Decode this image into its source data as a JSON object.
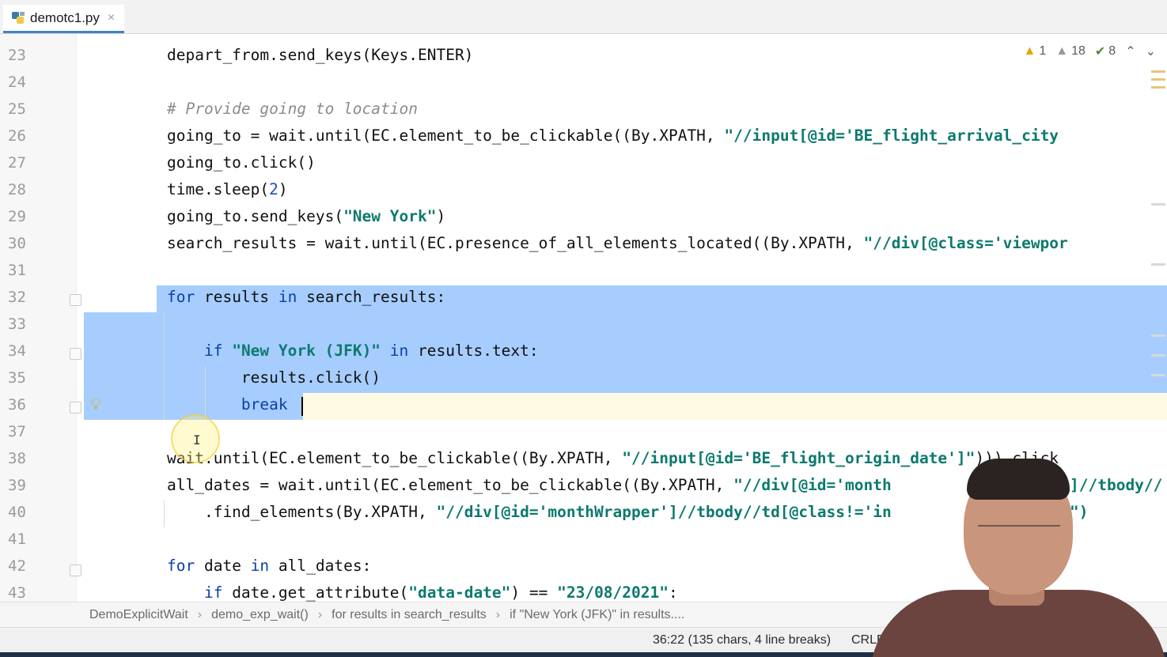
{
  "tab": {
    "filename": "demotc1.py",
    "close": "×",
    "icon": "python-file-icon"
  },
  "inspections": {
    "warnings": "1",
    "weak_warnings": "18",
    "typos": "8"
  },
  "code_lines": [
    {
      "num": "23",
      "text": "depart_from.send_keys(Keys.ENTER)"
    },
    {
      "num": "24",
      "text": ""
    },
    {
      "num": "25",
      "text": "# Provide going to location"
    },
    {
      "num": "26",
      "text": "going_to = wait.until(EC.element_to_be_clickable((By.XPATH, \"//input[@id='BE_flight_arrival_city"
    },
    {
      "num": "27",
      "text": "going_to.click()"
    },
    {
      "num": "28",
      "text": "time.sleep(2)"
    },
    {
      "num": "29",
      "text": "going_to.send_keys(\"New York\")"
    },
    {
      "num": "30",
      "text": "search_results = wait.until(EC.presence_of_all_elements_located((By.XPATH, \"//div[@class='viewpor"
    },
    {
      "num": "31",
      "text": ""
    },
    {
      "num": "32",
      "text": "for results in search_results:"
    },
    {
      "num": "33",
      "text": ""
    },
    {
      "num": "34",
      "text": "    if \"New York (JFK)\" in results.text:"
    },
    {
      "num": "35",
      "text": "        results.click()"
    },
    {
      "num": "36",
      "text": "        break"
    },
    {
      "num": "37",
      "text": ""
    },
    {
      "num": "38",
      "text": "wait.until(EC.element_to_be_clickable((By.XPATH, \"//input[@id='BE_flight_origin_date']\"))).click"
    },
    {
      "num": "39",
      "text": "all_dates = wait.until(EC.element_to_be_clickable((By.XPATH, \"//div[@id='month"
    },
    {
      "num": "40",
      "text": "    .find_elements(By.XPATH, \"//div[@id='monthWrapper']//tbody//td[@class!='in"
    },
    {
      "num": "41",
      "text": ""
    },
    {
      "num": "42",
      "text": "for date in all_dates:"
    },
    {
      "num": "43",
      "text": "    if date.get_attribute(\"data-date\") == \"23/08/2021\":"
    }
  ],
  "line39_tail": "]//tbody//",
  "line40_tail": "\")",
  "breadcrumb": [
    "DemoExplicitWait",
    "demo_exp_wait()",
    "for results in search_results",
    "if \"New York (JFK)\" in results...."
  ],
  "status": {
    "position": "36:22 (135 chars, 4 line breaks)",
    "line_ending": "CRLF"
  }
}
